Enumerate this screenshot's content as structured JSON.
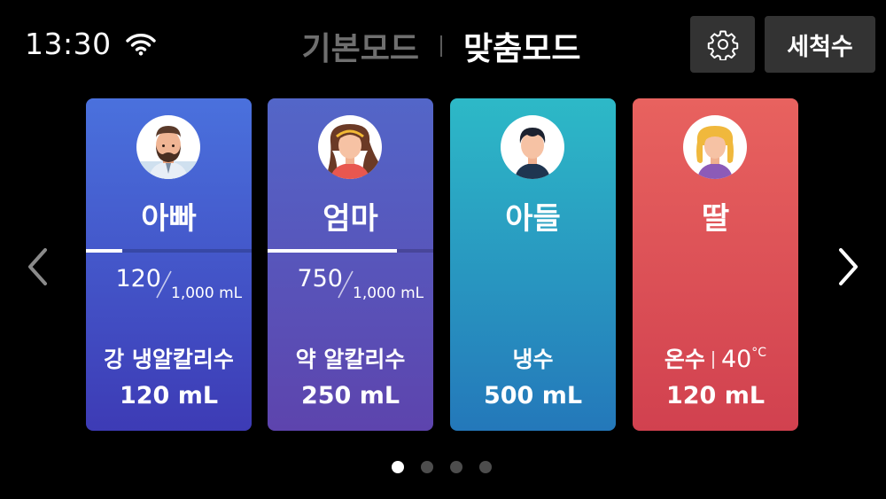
{
  "status": {
    "time": "13:30",
    "wifi_icon": "wifi-icon"
  },
  "mode_tabs": [
    {
      "label": "기본모드",
      "active": false
    },
    {
      "label": "맞춤모드",
      "active": true
    }
  ],
  "header_buttons": {
    "settings_icon": "gear-icon",
    "clean_label": "세척수"
  },
  "nav": {
    "prev_icon": "chevron-left-icon",
    "next_icon": "chevron-right-icon"
  },
  "profiles": [
    {
      "name": "아빠",
      "avatar_icon": "man-beard-avatar-icon",
      "usage_now": "120",
      "usage_max": "1,000 mL",
      "usage_fraction": 0.22,
      "water_type": "강 냉알칼리수",
      "amount": "120 mL"
    },
    {
      "name": "엄마",
      "avatar_icon": "woman-avatar-icon",
      "usage_now": "750",
      "usage_max": "1,000 mL",
      "usage_fraction": 0.78,
      "water_type": "약 알칼리수",
      "amount": "250 mL"
    },
    {
      "name": "아들",
      "avatar_icon": "boy-avatar-icon",
      "water_type": "냉수",
      "amount": "500 mL"
    },
    {
      "name": "딸",
      "avatar_icon": "girl-avatar-icon",
      "water_type": "온수",
      "temperature": "40",
      "temperature_unit": "°C",
      "amount": "120 mL"
    }
  ],
  "pagination": {
    "count": 4,
    "active_index": 0
  },
  "colors": {
    "background": "#000000",
    "button_bg": "#333333",
    "inactive_text": "#6f6f6f",
    "card_dad": "#4a71dd",
    "card_mom": "#5366c8",
    "card_son": "#2db9c7",
    "card_daughter": "#e8625f"
  }
}
